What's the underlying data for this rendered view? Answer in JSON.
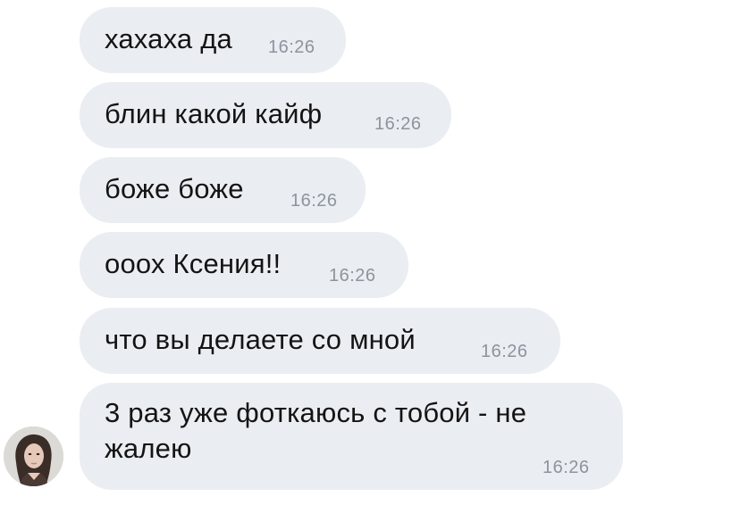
{
  "messages": [
    {
      "text": "хахаха да",
      "time": "16:26"
    },
    {
      "text": "блин какой кайф",
      "time": "16:26"
    },
    {
      "text": "боже боже",
      "time": "16:26"
    },
    {
      "text": "ооох Ксения!!",
      "time": "16:26"
    },
    {
      "text": "что вы делаете со мной",
      "time": "16:26"
    },
    {
      "text": "3 раз уже фоткаюсь с тобой - не жалею",
      "time": "16:26"
    }
  ],
  "colors": {
    "bubble": "#eaedf1",
    "text": "#141414",
    "time": "#8c949e"
  },
  "icons": {
    "avatar": "sender-avatar-photo"
  }
}
